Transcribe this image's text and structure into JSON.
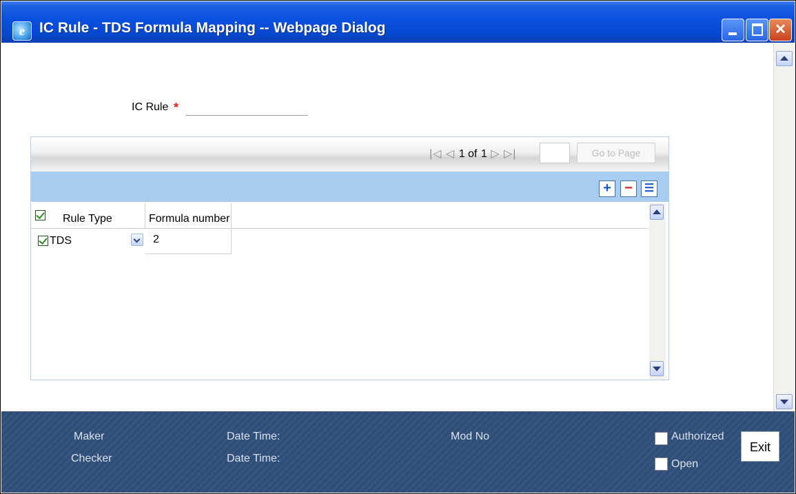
{
  "window": {
    "title": "IC Rule - TDS Formula Mapping -- Webpage Dialog",
    "icon": "ie-icon",
    "title_icon_glyph": "e"
  },
  "form": {
    "ic_rule_label": "IC Rule",
    "required_mark": "*",
    "ic_rule_value": ""
  },
  "pagination": {
    "current": "1 of",
    "total": "1",
    "page_input": "",
    "goto_label": "Go to Page"
  },
  "toolbar": {
    "add_label": "+",
    "delete_label": "−",
    "view_label": "☰"
  },
  "table": {
    "columns": [
      "Rule Type",
      "Formula number"
    ],
    "rows": [
      {
        "checked": true,
        "rule_type": "TDS",
        "formula_number": "2"
      }
    ]
  },
  "footer": {
    "maker_label": "Maker",
    "checker_label": "Checker",
    "date_time_label": "Date Time:",
    "mod_no_label": "Mod No",
    "authorized_label": "Authorized",
    "open_label": "Open",
    "exit_label": "Exit"
  },
  "colors": {
    "title_bar": "#0a4fdd",
    "grid_toolbar": "#a8cdf1",
    "footer": "#2f4e78",
    "required": "#e3211c"
  }
}
